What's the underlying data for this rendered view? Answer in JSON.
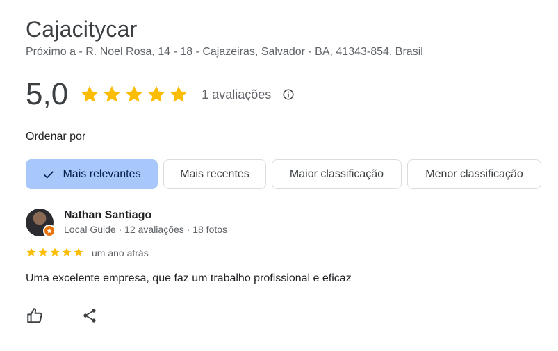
{
  "place": {
    "name": "Cajacitycar",
    "address": "Próximo a - R. Noel Rosa, 14 - 18 - Cajazeiras, Salvador - BA, 41343-854, Brasil"
  },
  "rating": {
    "value": "5,0",
    "stars": 5,
    "count_label": "1 avaliações"
  },
  "sort": {
    "label": "Ordenar por",
    "options": [
      "Mais relevantes",
      "Mais recentes",
      "Maior classificação",
      "Menor classificação"
    ],
    "selected": "Mais relevantes"
  },
  "review": {
    "author": "Nathan Santiago",
    "meta": "Local Guide · 12 avaliações · 18 fotos",
    "stars": 5,
    "time": "um ano atrás",
    "text": "Uma excelente empresa, que faz um trabalho profissional e eficaz"
  },
  "colors": {
    "star": "#fbbc04",
    "selected_chip": "#a8c7fa",
    "badge": "#e8710a"
  }
}
